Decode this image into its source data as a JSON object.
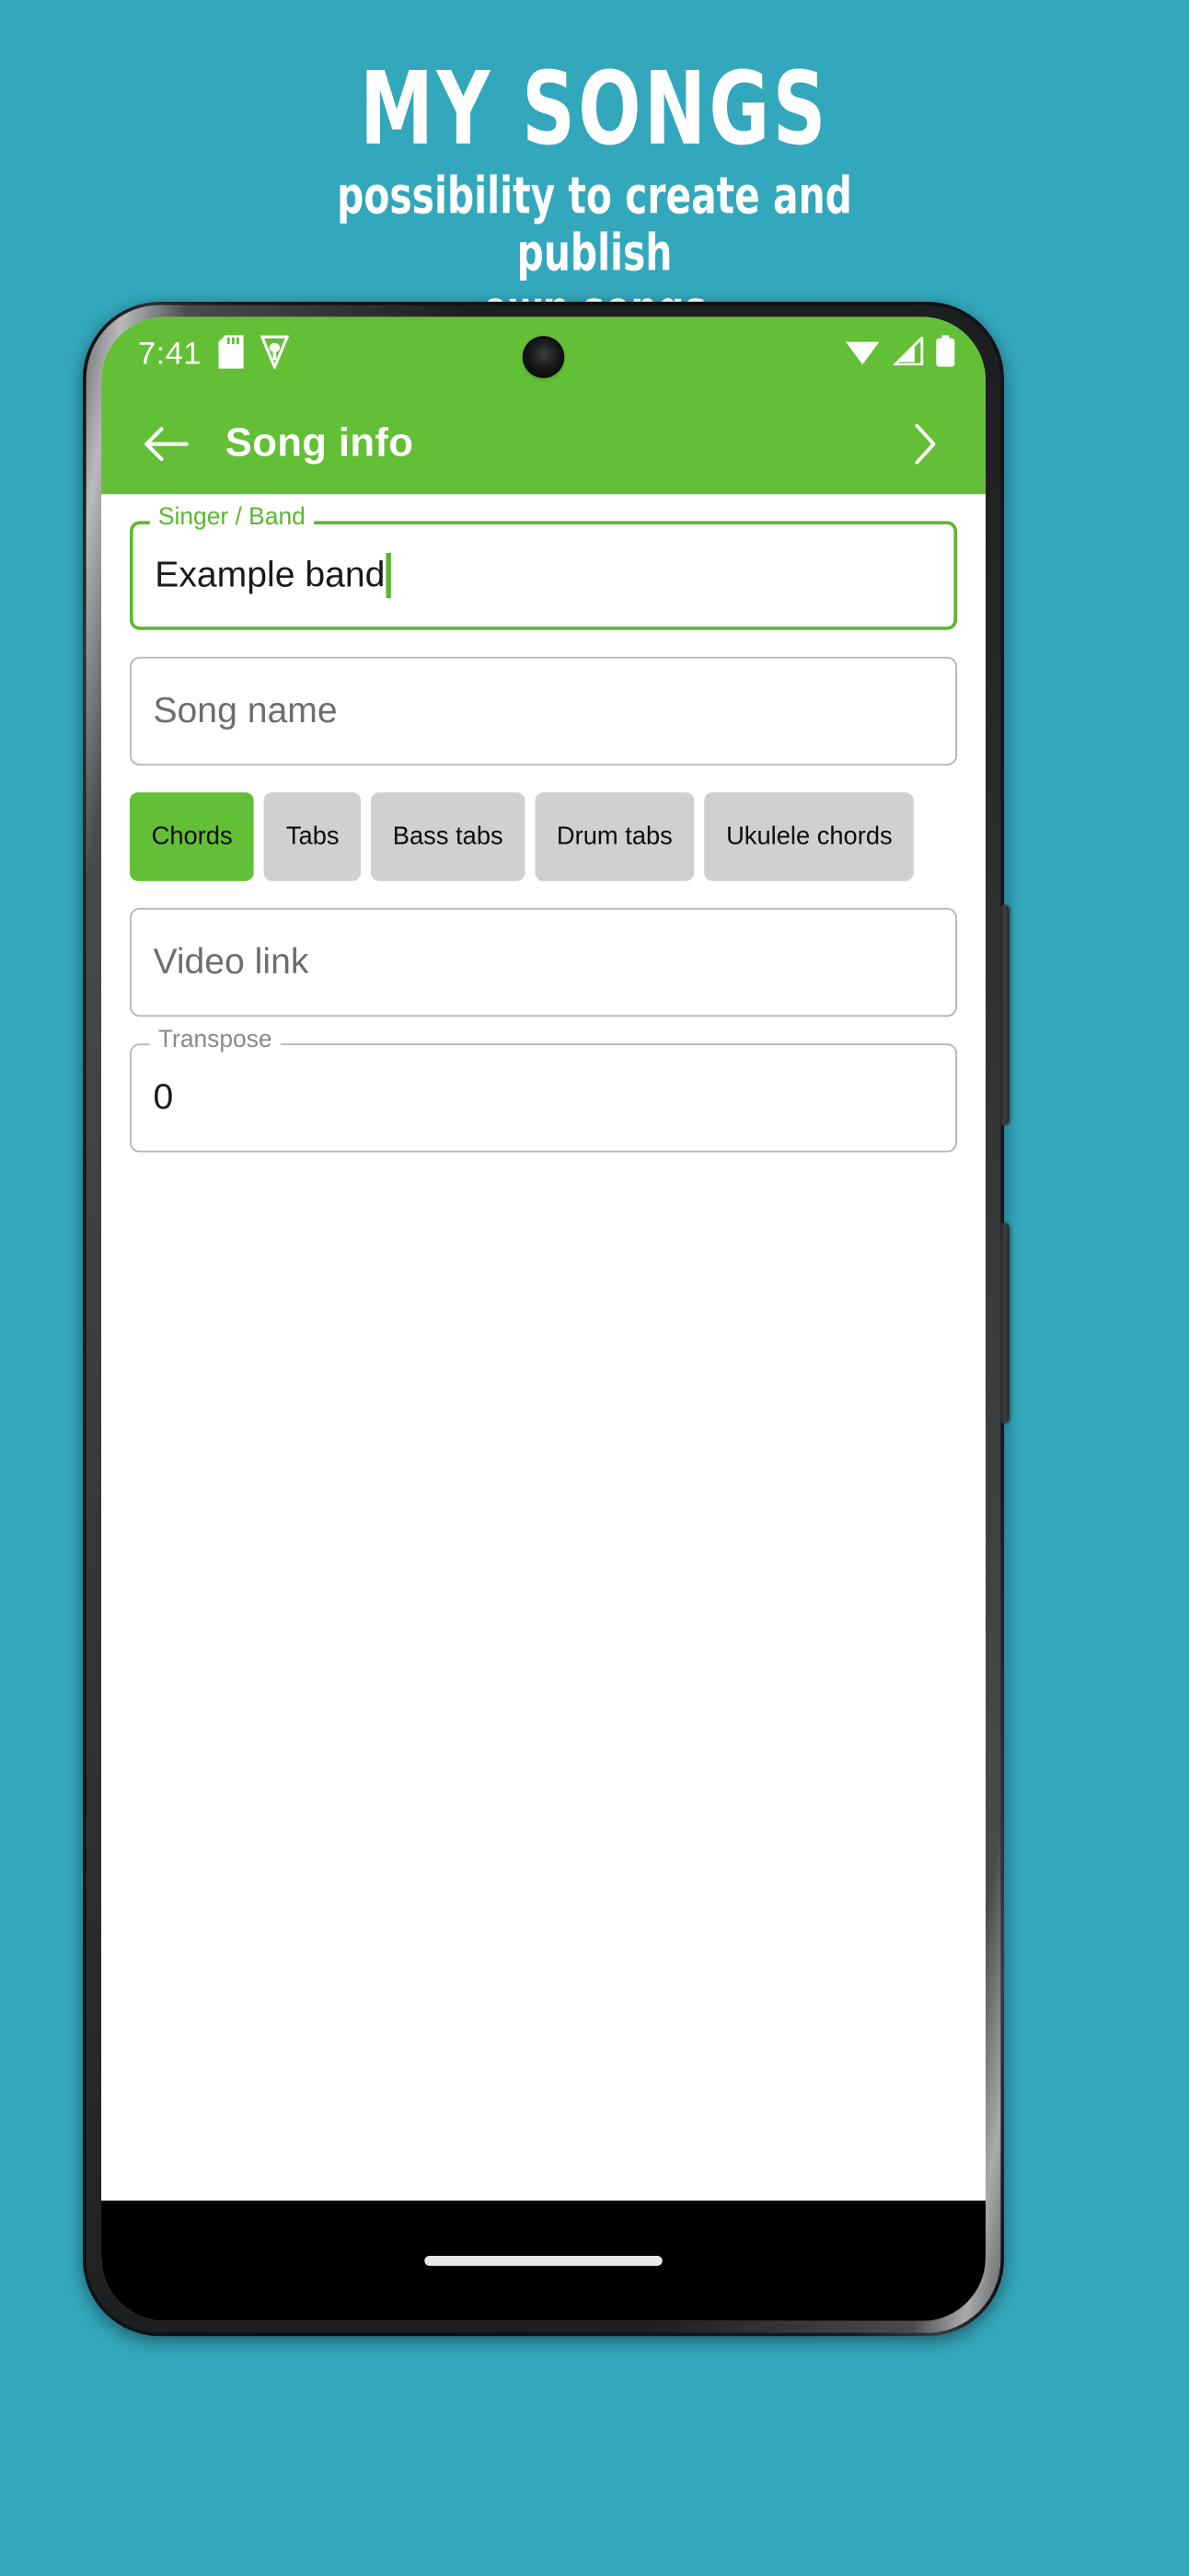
{
  "promo": {
    "title": "MY SONGS",
    "subtitle_line1": "possibility to create and",
    "subtitle_line2": "publish",
    "subtitle_line3": "own songs",
    "background_color": "#33a7bb",
    "text_color": "#ffffff"
  },
  "status_bar": {
    "time": "7:41",
    "background_color": "#63bf35",
    "left_icons": [
      "sd-card-icon",
      "shield-icon"
    ],
    "right_icons": [
      "wifi-icon",
      "cellular-signal-icon",
      "battery-icon"
    ]
  },
  "app_bar": {
    "title": "Song info",
    "back_icon": "arrow-left-icon",
    "next_icon": "chevron-right-icon",
    "background_color": "#63bf35",
    "text_color": "#ffffff"
  },
  "form": {
    "singer_band": {
      "legend": "Singer / Band",
      "value": "Example band",
      "placeholder": "Singer / Band",
      "focused": true,
      "accent_color": "#5cb731"
    },
    "song_name": {
      "legend": "",
      "value": "",
      "placeholder": "Song name",
      "focused": false
    },
    "video_link": {
      "legend": "",
      "value": "",
      "placeholder": "Video link",
      "focused": false
    },
    "transpose": {
      "legend": "Transpose",
      "value": "0",
      "placeholder": "Transpose",
      "focused": false
    }
  },
  "chips": {
    "selected_index": 0,
    "items": [
      {
        "label": "Chords"
      },
      {
        "label": "Tabs"
      },
      {
        "label": "Bass tabs"
      },
      {
        "label": "Drum tabs"
      },
      {
        "label": "Ukulele chords"
      }
    ]
  },
  "nav_bar": {
    "gesture_pill": true,
    "background_color": "#000000"
  }
}
